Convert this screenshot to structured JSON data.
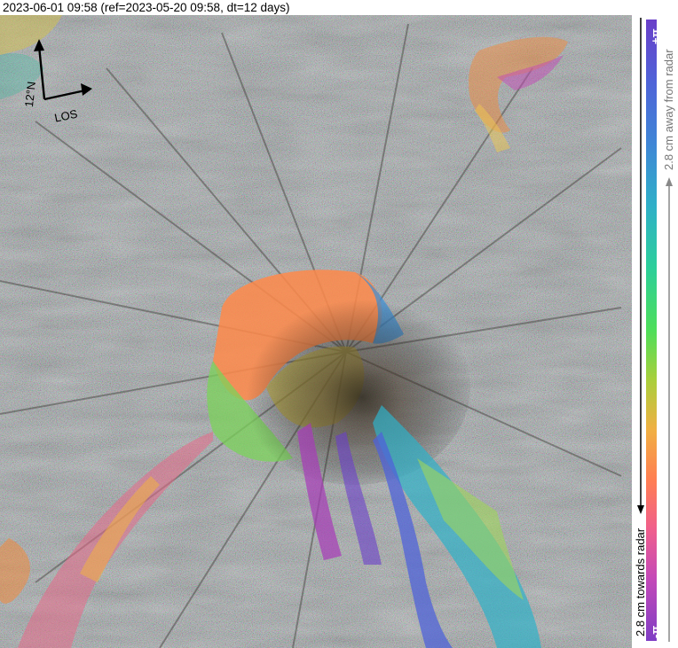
{
  "title": "2023-06-01 09:58 (ref=2023-05-20 09:58, dt=12 days)",
  "compass": {
    "north_label": "12°N",
    "los_label": "LOS"
  },
  "colorbar": {
    "top_label": "+π",
    "bottom_label": "-π",
    "away_label": "2.8 cm away from radar",
    "towards_label": "2.8 cm towards radar",
    "colors": [
      "#6a3fc9",
      "#3f86d6",
      "#2ccf9a",
      "#4ede5a",
      "#f0b043",
      "#ff7f52",
      "#c449b8",
      "#7f3ec4"
    ]
  },
  "image": {
    "subject": "interferogram-volcano",
    "background_color": "#8c8a86"
  }
}
